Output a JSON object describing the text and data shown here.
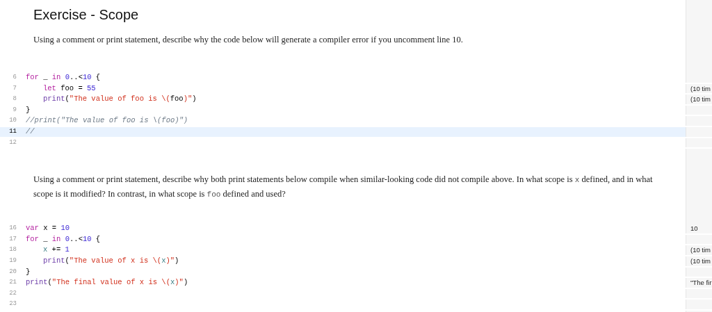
{
  "title": "Exercise - Scope",
  "blocks": [
    {
      "kind": "prose",
      "segments": [
        {
          "kind": "text",
          "text": "Using a comment or print statement, describe why the code below will generate a compiler error if you uncomment line 10."
        }
      ]
    },
    {
      "kind": "code",
      "lines": [
        {
          "number": "6",
          "current": false,
          "indented": false,
          "tokens": [
            {
              "kind": "keyword",
              "text": "for"
            },
            {
              "kind": "plain",
              "text": " _ "
            },
            {
              "kind": "keyword",
              "text": "in "
            },
            {
              "kind": "number",
              "text": "0"
            },
            {
              "kind": "plain",
              "text": "..<"
            },
            {
              "kind": "number",
              "text": "10"
            },
            {
              "kind": "plain",
              "text": " {"
            }
          ]
        },
        {
          "number": "7",
          "current": false,
          "indented": true,
          "result": "(10 tim",
          "tokens": [
            {
              "kind": "keyword",
              "text": "let"
            },
            {
              "kind": "plain",
              "text": " foo = "
            },
            {
              "kind": "number",
              "text": "55"
            }
          ]
        },
        {
          "number": "8",
          "current": false,
          "indented": true,
          "result": "(10 tim",
          "tokens": [
            {
              "kind": "function",
              "text": "print"
            },
            {
              "kind": "plain",
              "text": "("
            },
            {
              "kind": "string",
              "text": "\"The value of foo is \\("
            },
            {
              "kind": "plain",
              "text": "foo"
            },
            {
              "kind": "string",
              "text": ")\""
            },
            {
              "kind": "plain",
              "text": ")"
            }
          ]
        },
        {
          "number": "9",
          "current": false,
          "indented": false,
          "tokens": [
            {
              "kind": "plain",
              "text": "}"
            }
          ]
        },
        {
          "number": "10",
          "current": false,
          "indented": false,
          "tokens": [
            {
              "kind": "comment",
              "text": "//print(\"The value of foo is \\(foo)\")"
            }
          ]
        },
        {
          "number": "11",
          "current": true,
          "indented": false,
          "tokens": [
            {
              "kind": "comment",
              "text": "//"
            }
          ]
        },
        {
          "number": "12",
          "current": false
        }
      ]
    },
    {
      "kind": "prose",
      "segments": [
        {
          "kind": "text",
          "text": "Using a comment or print statement, describe why both print statements below compile when similar-looking code did not compile above. In what scope is "
        },
        {
          "kind": "code",
          "text": "x"
        },
        {
          "kind": "text",
          "text": " defined, and in what scope is it modified? In contrast, in what scope is "
        },
        {
          "kind": "code",
          "text": "foo"
        },
        {
          "kind": "text",
          "text": " defined and used?"
        }
      ]
    },
    {
      "kind": "code",
      "lines": [
        {
          "number": "16",
          "current": false,
          "indented": false,
          "result": "10",
          "tokens": [
            {
              "kind": "keyword",
              "text": "var"
            },
            {
              "kind": "plain",
              "text": " x = "
            },
            {
              "kind": "number",
              "text": "10"
            }
          ]
        },
        {
          "number": "17",
          "current": false,
          "indented": false,
          "tokens": [
            {
              "kind": "keyword",
              "text": "for"
            },
            {
              "kind": "plain",
              "text": " _ "
            },
            {
              "kind": "keyword",
              "text": "in "
            },
            {
              "kind": "number",
              "text": "0"
            },
            {
              "kind": "plain",
              "text": "..<"
            },
            {
              "kind": "number",
              "text": "10"
            },
            {
              "kind": "plain",
              "text": " {"
            }
          ]
        },
        {
          "number": "18",
          "current": false,
          "indented": true,
          "result": "(10 tim",
          "tokens": [
            {
              "kind": "variable",
              "text": "x"
            },
            {
              "kind": "plain",
              "text": " += "
            },
            {
              "kind": "number",
              "text": "1"
            }
          ]
        },
        {
          "number": "19",
          "current": false,
          "indented": true,
          "result": "(10 tim",
          "tokens": [
            {
              "kind": "function",
              "text": "print"
            },
            {
              "kind": "plain",
              "text": "("
            },
            {
              "kind": "string",
              "text": "\"The value of x is \\("
            },
            {
              "kind": "variable",
              "text": "x"
            },
            {
              "kind": "string",
              "text": ")\""
            },
            {
              "kind": "plain",
              "text": ")"
            }
          ]
        },
        {
          "number": "20",
          "current": false,
          "indented": false,
          "tokens": [
            {
              "kind": "plain",
              "text": "}"
            }
          ]
        },
        {
          "number": "21",
          "current": false,
          "indented": false,
          "result": "\"The fir",
          "tokens": [
            {
              "kind": "function",
              "text": "print"
            },
            {
              "kind": "plain",
              "text": "("
            },
            {
              "kind": "string",
              "text": "\"The final value of x is \\("
            },
            {
              "kind": "variable",
              "text": "x"
            },
            {
              "kind": "string",
              "text": ")\""
            },
            {
              "kind": "plain",
              "text": ")"
            }
          ]
        },
        {
          "number": "22",
          "current": false
        },
        {
          "number": "23",
          "current": false
        }
      ]
    }
  ]
}
